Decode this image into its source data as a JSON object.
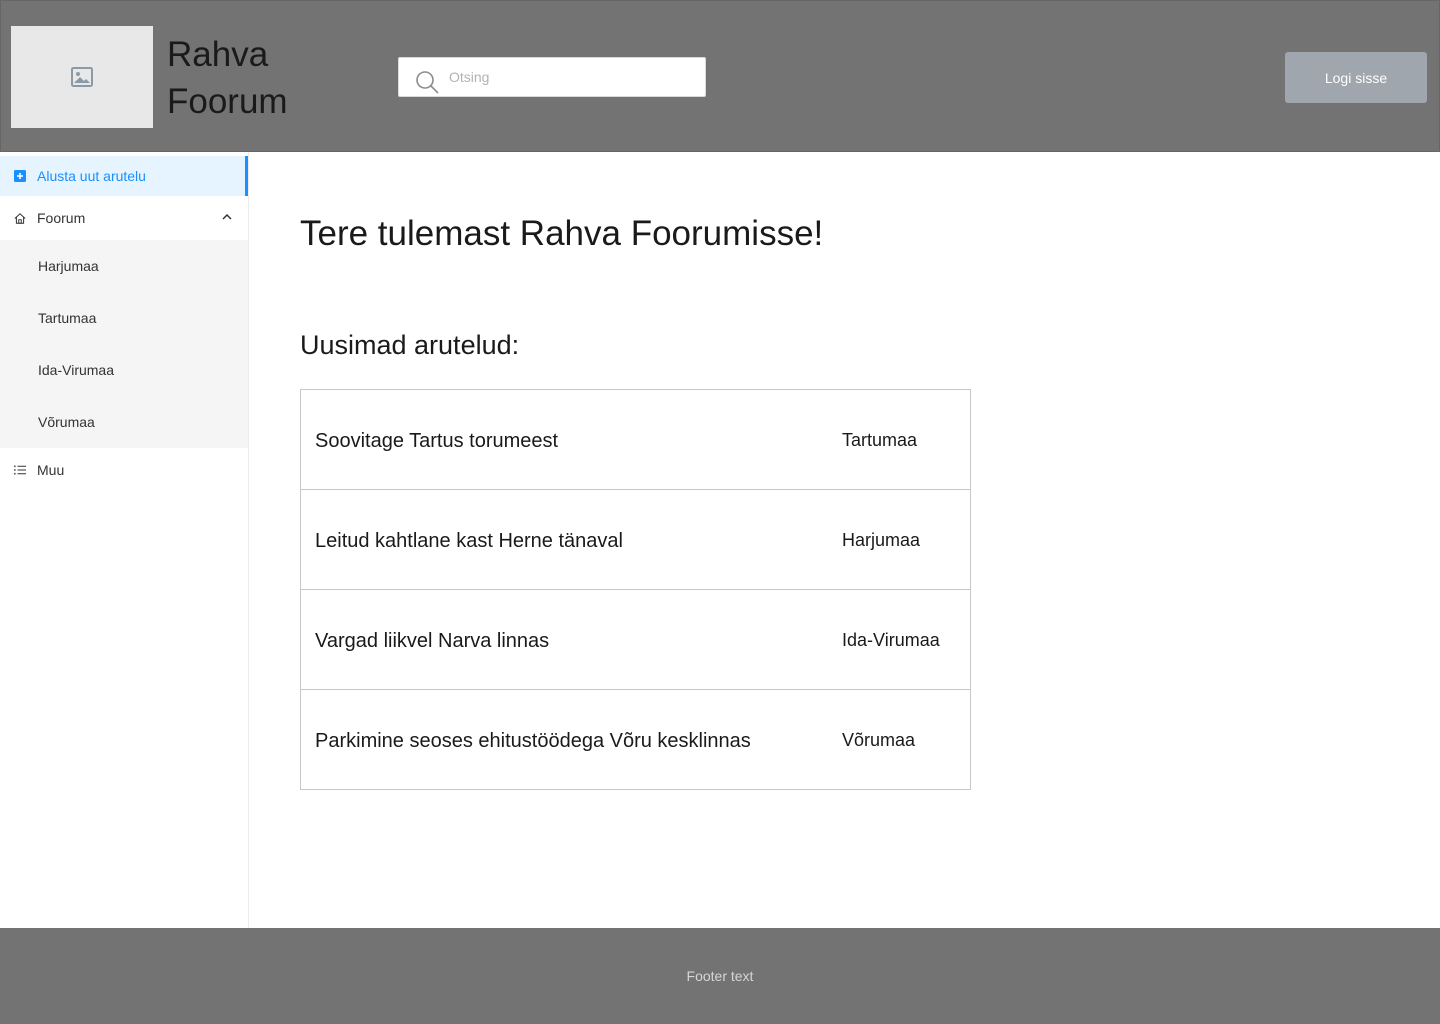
{
  "header": {
    "site_title": "Rahva Foorum",
    "search_placeholder": "Otsing",
    "login_label": "Logi sisse"
  },
  "sidebar": {
    "new_discussion_label": "Alusta uut arutelu",
    "forum_label": "Foorum",
    "forum_subitems": [
      "Harjumaa",
      "Tartumaa",
      "Ida-Virumaa",
      "Võrumaa"
    ],
    "other_label": "Muu"
  },
  "main": {
    "welcome_title": "Tere tulemast Rahva Foorumisse!",
    "latest_heading": "Uusimad arutelud:",
    "threads": [
      {
        "title": "Soovitage Tartus torumeest",
        "region": "Tartumaa"
      },
      {
        "title": "Leitud kahtlane kast Herne tänaval",
        "region": "Harjumaa"
      },
      {
        "title": "Vargad liikvel Narva linnas",
        "region": "Ida-Virumaa"
      },
      {
        "title": "Parkimine seoses ehitustöödega Võru kesklinnas",
        "region": "Võrumaa"
      }
    ]
  },
  "footer": {
    "text": "Footer text"
  },
  "colors": {
    "header_bg": "#737373",
    "accent": "#1890ff",
    "active_bg": "#e6f4ff",
    "login_bg": "#a0a6ad"
  }
}
